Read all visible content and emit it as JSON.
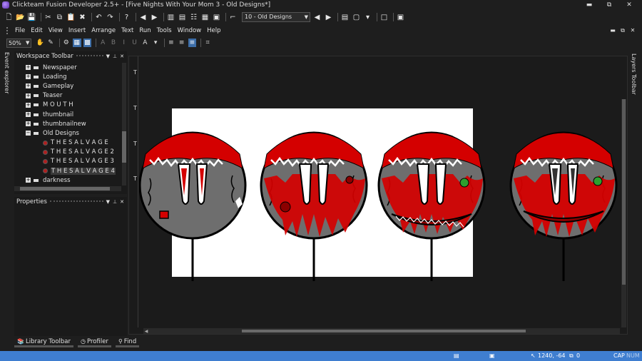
{
  "window": {
    "title": "Clickteam Fusion Developer 2.5+ - [Five Nights With Your Mom 3 - Old Designs*]",
    "minimize": "▬",
    "maximize": "⧉",
    "close": "✕"
  },
  "toolbar": {
    "frame_select": "10 - Old Designs"
  },
  "menu": {
    "items": [
      "File",
      "Edit",
      "View",
      "Insert",
      "Arrange",
      "Text",
      "Run",
      "Tools",
      "Window",
      "Help"
    ],
    "mdi_buttons": [
      "▬",
      "⧉",
      "✕"
    ]
  },
  "edit_toolbar": {
    "zoom": "50%"
  },
  "side_tabs": {
    "left": "Event explorer",
    "right": "Layers Toolbar"
  },
  "workspace": {
    "title": "Workspace Toolbar",
    "frames": [
      "Newspaper",
      "Loading",
      "Gameplay",
      "Teaser",
      "M O U T H",
      "thumbnail",
      "thumbnailnew",
      "Old Designs"
    ],
    "children": [
      "T H E S A L V A G E",
      "T H E S A L V A G E 2",
      "T H E S A L V A G E 3",
      "T H E S A L V A G E 4"
    ],
    "after": "darkness"
  },
  "properties": {
    "title": "Properties"
  },
  "editor": {
    "ruler_marks": [
      "T",
      "T",
      "T",
      "T"
    ]
  },
  "bottom_tabs": [
    "Library Toolbar",
    "Profiler",
    "Find"
  ],
  "status": {
    "coords": "1240, -64",
    "count": "0",
    "caps": "CAP",
    "num": "NUM"
  },
  "colors": {
    "status_bar": "#3f7ed0",
    "blood_red": "#d40000",
    "gray_face": "#6e6e6e"
  }
}
